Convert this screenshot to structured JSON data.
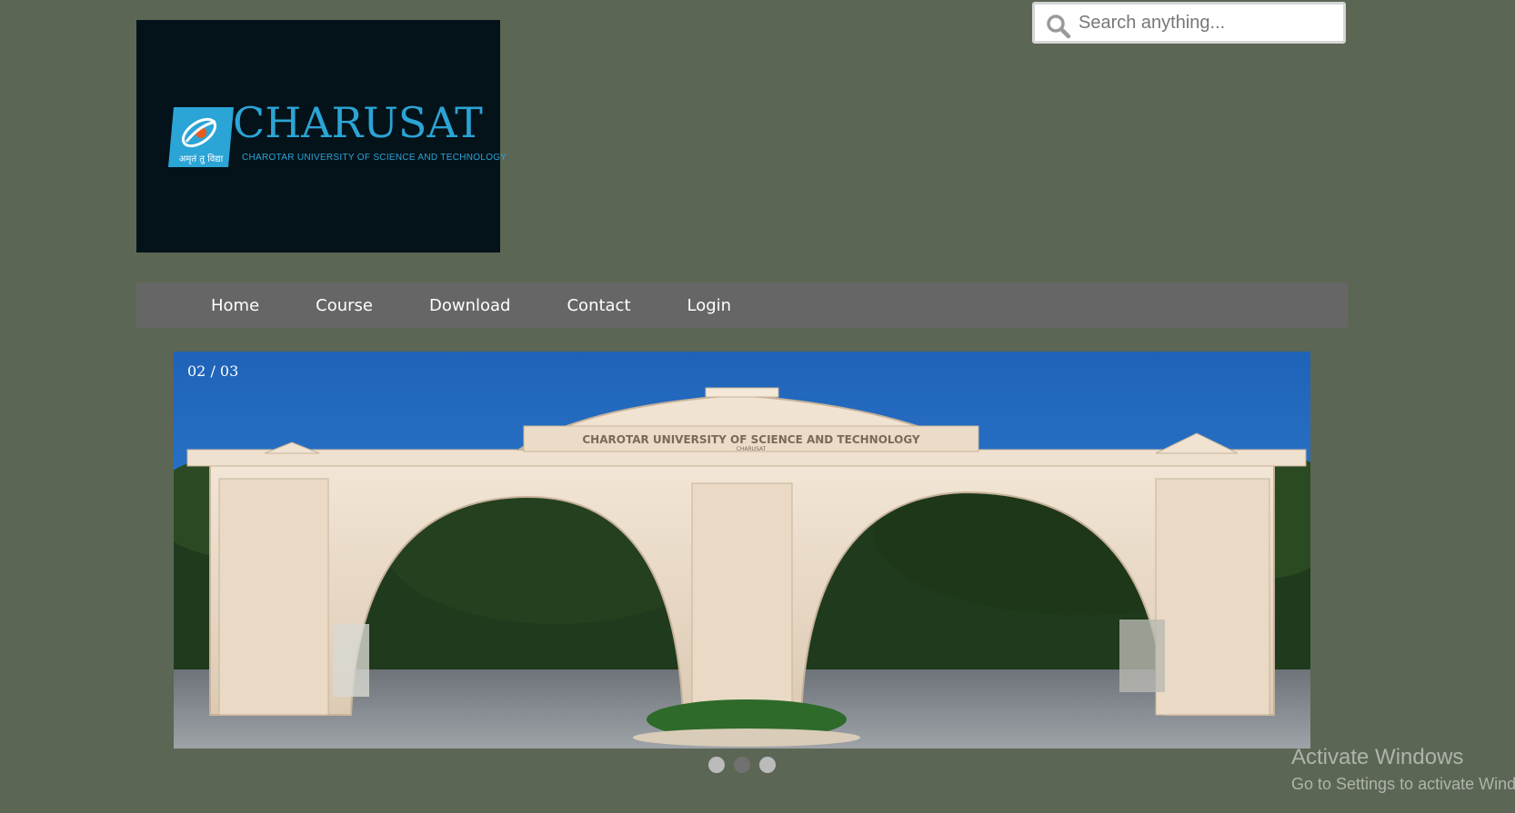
{
  "logo": {
    "wordmark": "CHARUSAT",
    "tagline": "CHAROTAR UNIVERSITY OF SCIENCE AND TECHNOLOGY",
    "emblem_caption": "अमृतं तु विद्या"
  },
  "search": {
    "placeholder": "Search anything...",
    "value": ""
  },
  "nav": {
    "items": [
      {
        "label": "Home"
      },
      {
        "label": "Course"
      },
      {
        "label": "Download"
      },
      {
        "label": "Contact"
      },
      {
        "label": "Login"
      }
    ]
  },
  "slideshow": {
    "counter": "02 / 03",
    "current": 2,
    "total": 3,
    "gate_inscription": "CHAROTAR UNIVERSITY OF SCIENCE AND TECHNOLOGY",
    "gate_subinscription": "CHARUSAT"
  },
  "watermark": {
    "title": "Activate Windows",
    "subtitle": "Go to Settings to activate Windows."
  },
  "colors": {
    "background": "#5c6654",
    "navbar": "#666666",
    "brand": "#2ba4d6",
    "logo_bg": "#04131a"
  }
}
